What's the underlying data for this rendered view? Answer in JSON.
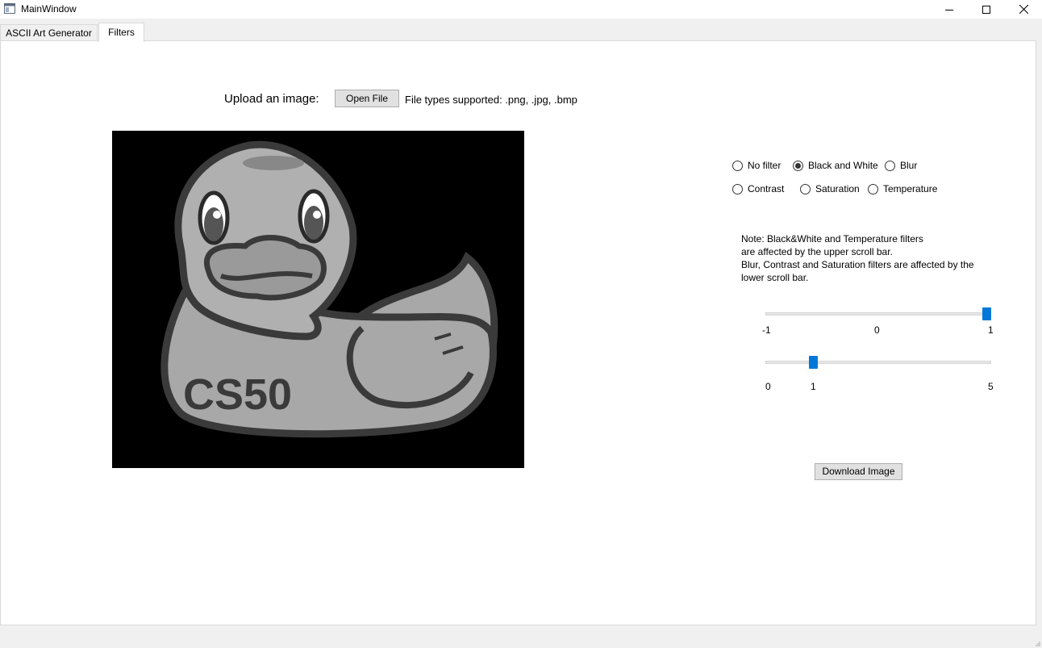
{
  "window": {
    "title": "MainWindow"
  },
  "tabs": [
    {
      "label": "ASCII Art Generator",
      "active": false
    },
    {
      "label": "Filters",
      "active": true
    }
  ],
  "upload": {
    "label": "Upload an image:",
    "button_label": "Open File",
    "file_types": "File types supported: .png, .jpg, .bmp"
  },
  "preview": {
    "logo_text": "CS50"
  },
  "filters": {
    "selected": "Black and White",
    "options": [
      {
        "label": "No filter",
        "checked": false
      },
      {
        "label": "Black and White",
        "checked": true
      },
      {
        "label": "Blur",
        "checked": false
      },
      {
        "label": "Contrast",
        "checked": false
      },
      {
        "label": "Saturation",
        "checked": false
      },
      {
        "label": "Temperature",
        "checked": false
      }
    ]
  },
  "note": {
    "lines": [
      "Note: Black&White and Temperature filters",
      "are affected by the upper scroll bar.",
      "Blur, Contrast and Saturation filters are affected by the",
      "lower scroll bar."
    ]
  },
  "slider_upper": {
    "min": -1,
    "max": 1,
    "value": 1,
    "labels": [
      "-1",
      "0",
      "1"
    ]
  },
  "slider_lower": {
    "min": 0,
    "max": 5,
    "value": 1,
    "labels": [
      "0",
      "1",
      "5"
    ]
  },
  "download": {
    "button_label": "Download Image"
  },
  "colors": {
    "accent": "#0078d7",
    "button_bg": "#e1e1e1",
    "panel_bg": "#ffffff"
  }
}
